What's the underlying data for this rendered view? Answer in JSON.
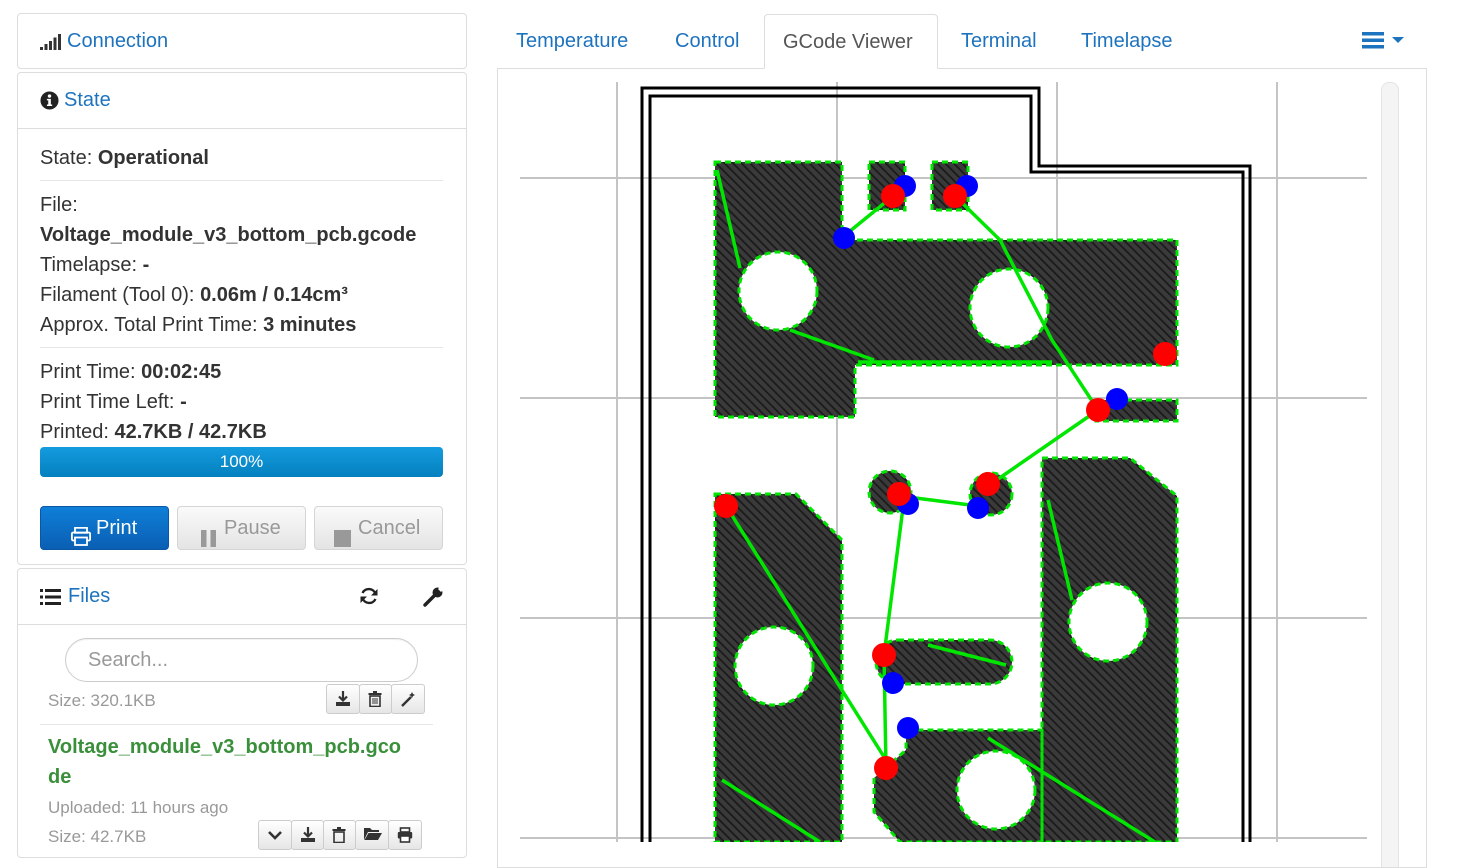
{
  "connection": {
    "title": "Connection",
    "icon": "signal-bars-icon"
  },
  "state": {
    "title": "State",
    "icon": "info-circle-icon",
    "state_label": "State: ",
    "state_value": "Operational",
    "file_label": "File:",
    "file_value": "Voltage_module_v3_bottom_pcb.gcode",
    "timelapse_label": "Timelapse: ",
    "timelapse_value": "-",
    "filament_label": "Filament (Tool 0): ",
    "filament_value": "0.06m / 0.14cm³",
    "approx_label": "Approx. Total Print Time: ",
    "approx_value": "3 minutes",
    "print_time_label": "Print Time: ",
    "print_time_value": "00:02:45",
    "print_left_label": "Print Time Left: ",
    "print_left_value": "-",
    "printed_label": "Printed: ",
    "printed_value": "42.7KB / 42.7KB",
    "progress_text": "100%",
    "progress_fraction": 1.0,
    "print_button": "Print",
    "pause_button": "Pause",
    "cancel_button": "Cancel"
  },
  "files": {
    "title": "Files",
    "icon": "list-icon",
    "refresh_icon": "refresh-icon",
    "settings_icon": "wrench-icon",
    "search_placeholder": "Search...",
    "items": [
      {
        "size": "Size: 320.1KB"
      },
      {
        "name": "Voltage_module_v3_bottom_pcb.gco de",
        "name_line1": "Voltage_module_v3_bottom_pcb.gco",
        "name_line2": "de",
        "uploaded": "Uploaded: 11 hours ago",
        "size": "Size: 42.7KB"
      }
    ]
  },
  "tabs": [
    {
      "label": "Temperature",
      "active": false
    },
    {
      "label": "Control",
      "active": false
    },
    {
      "label": "GCode Viewer",
      "active": true
    },
    {
      "label": "Terminal",
      "active": false
    },
    {
      "label": "Timelapse",
      "active": false
    }
  ],
  "tab_menu_icon": "hamburger-menu-icon",
  "colors": {
    "link": "#1e73be",
    "primary": "#0e6cc4",
    "file_name": "#3a8f3a",
    "toolpath_travel": "#00e600",
    "retract": "#ff0000",
    "prime": "#0000ff"
  }
}
